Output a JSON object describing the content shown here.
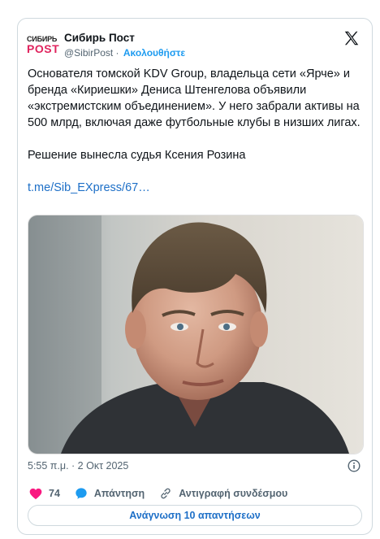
{
  "author": {
    "logo_line1": "СИБИРЬ",
    "logo_line2": "POST",
    "name": "Сибирь Пост",
    "handle": "@SibirPost",
    "separator": "·",
    "follow_label": "Ακολουθήστε"
  },
  "tweet": {
    "paragraph1": "Основателя томской KDV Group, владельца сети «Ярче» и бренда «Кириешки» Дениса Штенгелова объявили «экстремистским объединением». У него забрали активы на 500 млрд, включая даже футбольные клубы в низших лигах.",
    "paragraph2": "Решение вынесла судья Ксения Розина",
    "link": "t.me/Sib_EXpress/67…"
  },
  "meta": {
    "timestamp": "5:55 π.μ. · 2 Οκτ 2025"
  },
  "actions": {
    "like_count": "74",
    "reply_label": "Απάντηση",
    "copy_link_label": "Αντιγραφή συνδέσμου"
  },
  "read_replies_label": "Ανάγνωση 10 απαντήσεων",
  "colors": {
    "accent": "#1d9bf0",
    "link": "#1d6fc7",
    "like": "#f91880",
    "logo_red": "#e0245e"
  },
  "icons": [
    "x-logo-icon",
    "info-icon",
    "heart-icon",
    "reply-bubble-icon",
    "link-icon"
  ]
}
